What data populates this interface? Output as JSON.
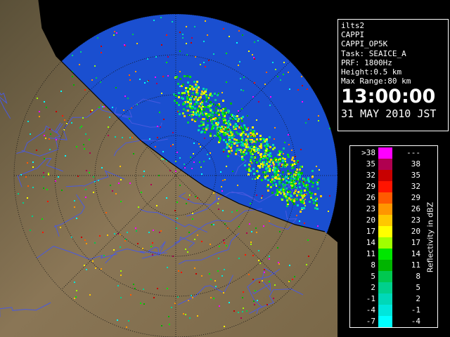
{
  "info": {
    "site": "ilts2",
    "product": "CAPPI",
    "product_id": "CAPPI_OP5K",
    "task": "Task: SEAICE_A",
    "prf": "PRF: 1800Hz",
    "height": "Height:0.5 km",
    "max_range": "Max Range:80 km",
    "time": "13:00:00",
    "date": "31 MAY 2010 JST"
  },
  "legend": {
    "unit_label": "Reflectivity in dBZ",
    "rows": [
      {
        "low": ">38",
        "high": "---",
        "color": "#ff00ff"
      },
      {
        "low": "35",
        "high": "38",
        "color": "#b00050"
      },
      {
        "low": "32",
        "high": "35",
        "color": "#c80000"
      },
      {
        "low": "29",
        "high": "32",
        "color": "#ff1400"
      },
      {
        "low": "26",
        "high": "29",
        "color": "#ff5a00"
      },
      {
        "low": "23",
        "high": "26",
        "color": "#ff9600"
      },
      {
        "low": "20",
        "high": "23",
        "color": "#ffc800"
      },
      {
        "low": "17",
        "high": "20",
        "color": "#ffff00"
      },
      {
        "low": "14",
        "high": "17",
        "color": "#a0ff00"
      },
      {
        "low": "11",
        "high": "14",
        "color": "#00e600"
      },
      {
        "low": "8",
        "high": "11",
        "color": "#00b400"
      },
      {
        "low": "5",
        "high": "8",
        "color": "#00c850"
      },
      {
        "low": "2",
        "high": "5",
        "color": "#00d08c"
      },
      {
        "low": "-1",
        "high": "2",
        "color": "#00d8b8"
      },
      {
        "low": "-4",
        "high": "-1",
        "color": "#00e6dc"
      },
      {
        "low": "-7",
        "high": "-4",
        "color": "#00ffff"
      }
    ]
  },
  "map": {
    "land_color": "#7a6a4e",
    "water_color": "#1a4fd0",
    "outside_color": "#000000",
    "river_color": "#4a5adf"
  }
}
